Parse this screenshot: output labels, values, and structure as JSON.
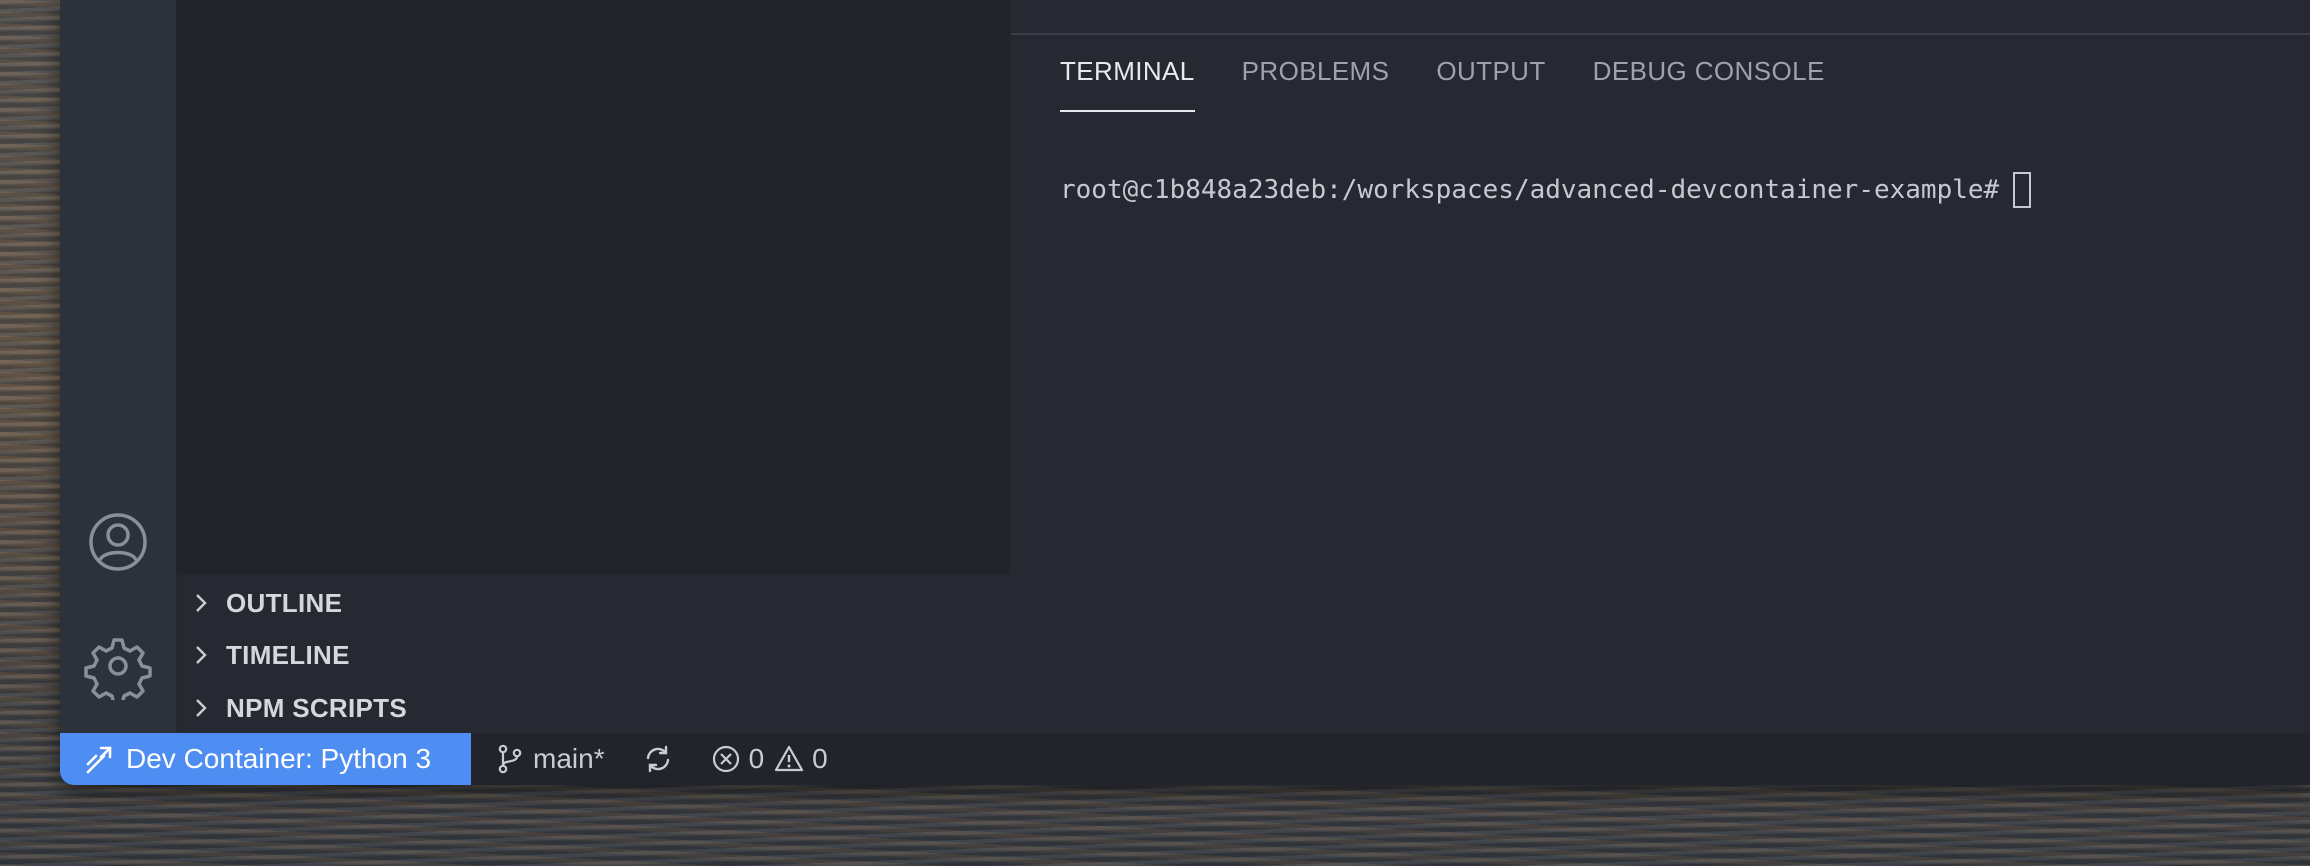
{
  "sidebar": {
    "sections": [
      {
        "label": "OUTLINE"
      },
      {
        "label": "TIMELINE"
      },
      {
        "label": "NPM SCRIPTS"
      }
    ]
  },
  "activity_bar": {
    "icons": [
      "account-icon",
      "manage-gear-icon"
    ]
  },
  "panel": {
    "tabs": [
      {
        "label": "TERMINAL",
        "active": true
      },
      {
        "label": "PROBLEMS",
        "active": false
      },
      {
        "label": "OUTPUT",
        "active": false
      },
      {
        "label": "DEBUG CONSOLE",
        "active": false
      }
    ],
    "terminal": {
      "prompt": "root@c1b848a23deb:/workspaces/advanced-devcontainer-example#"
    }
  },
  "statusbar": {
    "remote_label": "Dev Container: Python 3",
    "branch": "main*",
    "errors": "0",
    "warnings": "0"
  },
  "colors": {
    "accent": "#4e8df2",
    "background": "#262932",
    "sidebar": "#21242b"
  }
}
